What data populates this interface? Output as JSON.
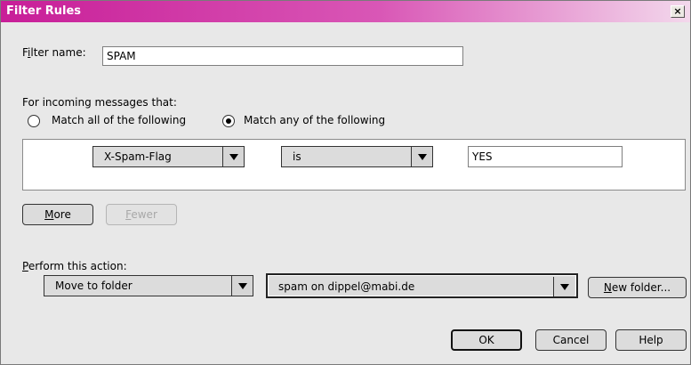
{
  "window": {
    "title": "Filter Rules",
    "close_glyph": "×"
  },
  "filter": {
    "name_label": "Filter name:",
    "name_value": "SPAM"
  },
  "match": {
    "heading": "For incoming messages that:",
    "all_label": "Match all of the following",
    "any_label": "Match any of the following",
    "selected": "any"
  },
  "rule": {
    "field": "X-Spam-Flag",
    "operator": "is",
    "value": "YES"
  },
  "rule_buttons": {
    "more": "More",
    "fewer": "Fewer"
  },
  "action": {
    "label": "Perform this action:",
    "type": "Move to folder",
    "folder": "spam on dippel@mabi.de",
    "new_folder": "New folder..."
  },
  "dialog_buttons": {
    "ok": "OK",
    "cancel": "Cancel",
    "help": "Help"
  },
  "icons": {
    "close": "close-icon",
    "dropdown": "chevron-down-icon",
    "radio": "radio-icon"
  }
}
